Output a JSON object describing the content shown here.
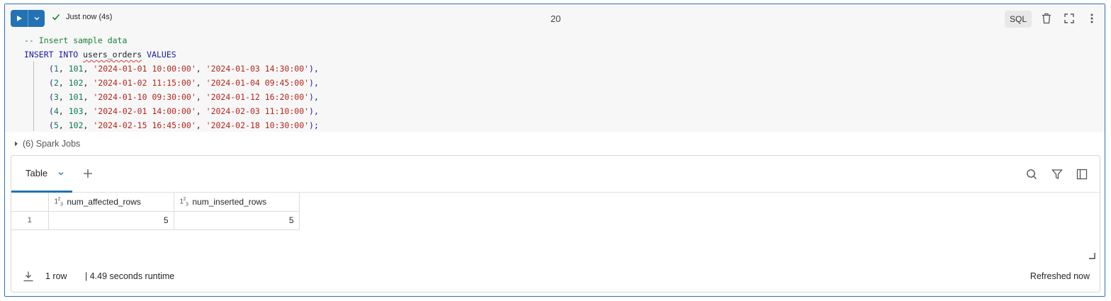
{
  "toolbar": {
    "status_text": "Just now (4s)",
    "cell_number": "20",
    "language": "SQL"
  },
  "code": {
    "comment": "-- Insert sample data",
    "kw_insert": "INSERT",
    "kw_into": "INTO",
    "table_name": "users_orders",
    "kw_values": "VALUES",
    "rows": [
      {
        "open": "(",
        "id": "1",
        "user": "101",
        "created": "'2024-01-01 10:00:00'",
        "shipped": "'2024-01-03 14:30:00'",
        "close": "),"
      },
      {
        "open": "(",
        "id": "2",
        "user": "102",
        "created": "'2024-01-02 11:15:00'",
        "shipped": "'2024-01-04 09:45:00'",
        "close": "),"
      },
      {
        "open": "(",
        "id": "3",
        "user": "101",
        "created": "'2024-01-10 09:30:00'",
        "shipped": "'2024-01-12 16:20:00'",
        "close": "),"
      },
      {
        "open": "(",
        "id": "4",
        "user": "103",
        "created": "'2024-02-01 14:00:00'",
        "shipped": "'2024-02-03 11:10:00'",
        "close": "),"
      },
      {
        "open": "(",
        "id": "5",
        "user": "102",
        "created": "'2024-02-15 16:45:00'",
        "shipped": "'2024-02-18 10:30:00'",
        "close": ");"
      }
    ]
  },
  "spark_jobs": "(6) Spark Jobs",
  "results": {
    "tab_label": "Table",
    "columns": [
      {
        "type_icon": "123",
        "name": "num_affected_rows"
      },
      {
        "type_icon": "123",
        "name": "num_inserted_rows"
      }
    ],
    "rows": [
      {
        "index": "1",
        "values": [
          "5",
          "5"
        ]
      }
    ],
    "footer": {
      "row_count": "1 row",
      "runtime": "| 4.49 seconds runtime",
      "refreshed": "Refreshed now"
    }
  },
  "colors": {
    "accent": "#2272b4",
    "keyword": "#1a1aa6",
    "string": "#b3261e",
    "number": "#0b7a5a",
    "comment": "#188038"
  },
  "icons": [
    "play-icon",
    "chevron-down-icon",
    "check-icon",
    "trash-icon",
    "expand-icon",
    "more-vertical-icon",
    "caret-right-icon",
    "plus-icon",
    "search-icon",
    "filter-icon",
    "sidebar-panel-icon",
    "download-icon",
    "resize-handle-icon"
  ]
}
